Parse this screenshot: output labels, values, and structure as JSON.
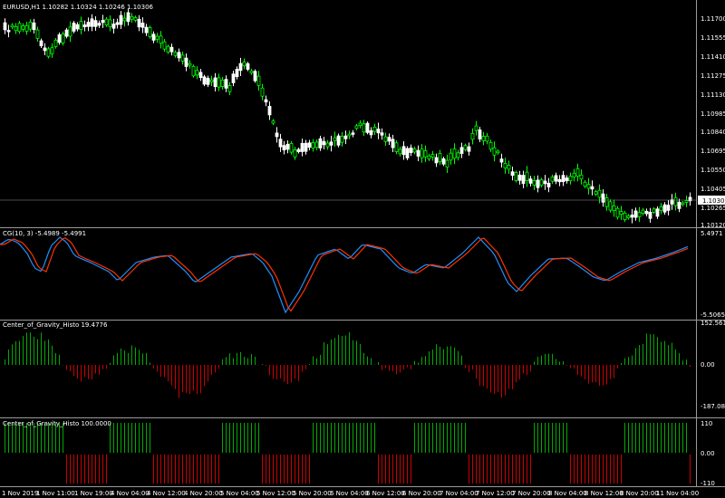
{
  "main": {
    "title": "EURUSD,H1  1.10282 1.10324 1.10246 1.10306",
    "axis_labels": [
      "1.11700",
      "1.11555",
      "1.11410",
      "1.11275",
      "1.11130",
      "1.10985",
      "1.10840",
      "1.10695",
      "1.10550",
      "1.10405",
      "1.10265",
      "1.10120"
    ],
    "current_price_label": "1.10306"
  },
  "cg": {
    "title": "CG(10, 3) -5.4989 -5.4991",
    "max_label": "5.4971",
    "min_label": "-5.5065"
  },
  "histo1": {
    "title": "Center_of_Gravity_Histo 19.4776",
    "labels": [
      "152.5616",
      "0.00",
      "-187.0885"
    ]
  },
  "histo2": {
    "title": "Center_of_Gravity_Histo 100.0000",
    "labels": [
      "110",
      "0.00",
      "-110"
    ]
  },
  "time_axis": [
    "1 Nov 2019",
    "1 Nov 11:00",
    "1 Nov 19:00",
    "4 Nov 04:00",
    "4 Nov 12:00",
    "4 Nov 20:00",
    "5 Nov 04:00",
    "5 Nov 12:00",
    "5 Nov 20:00",
    "6 Nov 04:00",
    "6 Nov 12:00",
    "6 Nov 20:00",
    "7 Nov 04:00",
    "7 Nov 12:00",
    "7 Nov 20:00",
    "8 Nov 04:00",
    "8 Nov 12:00",
    "8 Nov 20:00",
    "11 Nov 04:00"
  ],
  "colors": {
    "bull": "#00ff00",
    "bear": "#ffffff",
    "cg_line1": "#1e90ff",
    "cg_line2": "#ff3300",
    "histo_up": "#00aa00",
    "histo_down": "#cc0000",
    "separator": "#9a9a9a"
  }
}
